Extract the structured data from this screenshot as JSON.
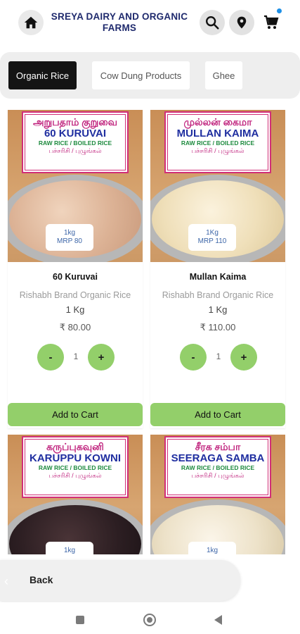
{
  "header": {
    "brand_line1": "SREYA DAIRY AND ORGANIC",
    "brand_line2": "FARMS",
    "icons": [
      "home-icon",
      "search-icon",
      "location-pin-icon",
      "cart-icon"
    ],
    "accent_color": "#1f2a6d",
    "cart_badge_color": "#1e90e6"
  },
  "categories": [
    {
      "label": "Organic Rice",
      "active": true
    },
    {
      "label": "Cow Dung Products",
      "active": false
    },
    {
      "label": "Ghee",
      "active": false
    }
  ],
  "products": [
    {
      "sign_tamil": "அறுபதாம் குறுவை",
      "sign_name": "60 KURUVAI",
      "sign_type": "RAW RICE / BOILED RICE",
      "sign_type_tamil": "பச்சரிசி / புழுங்கல்",
      "tag_line1": "1kg",
      "tag_line2": "MRP 80",
      "name": "60 Kuruvai",
      "brand": "Rishabh Brand Organic Rice",
      "quantity": "1 Kg",
      "price": "₹ 80.00",
      "stepper_minus": "-",
      "stepper_value": "1",
      "stepper_plus": "+",
      "add_label": "Add to Cart"
    },
    {
      "sign_tamil": "முல்லன் கைமா",
      "sign_name": "MULLAN KAIMA",
      "sign_type": "RAW RICE / BOILED RICE",
      "sign_type_tamil": "பச்சரிசி / புழுங்கல்",
      "tag_line1": "1Kg",
      "tag_line2": "MRP 110",
      "name": "Mullan Kaima",
      "brand": "Rishabh Brand Organic Rice",
      "quantity": "1 Kg",
      "price": "₹ 110.00",
      "stepper_minus": "-",
      "stepper_value": "1",
      "stepper_plus": "+",
      "add_label": "Add to Cart"
    },
    {
      "sign_tamil": "கருப்புகவுனி",
      "sign_name": "KARUPPU KOWNI",
      "sign_type": "RAW RICE / BOILED RICE",
      "sign_type_tamil": "பச்சரிசி / புழுங்கல்",
      "tag_line1": "1kg"
    },
    {
      "sign_tamil": "சீரக சம்பா",
      "sign_name": "SEERAGA SAMBA",
      "sign_type": "RAW RICE / BOILED RICE",
      "sign_type_tamil": "பச்சரிசி / புழுங்கல்",
      "tag_line1": "1kg"
    }
  ],
  "back": {
    "label": "Back"
  },
  "colors": {
    "button_green": "#93cf6a",
    "active_tab": "#141414"
  }
}
